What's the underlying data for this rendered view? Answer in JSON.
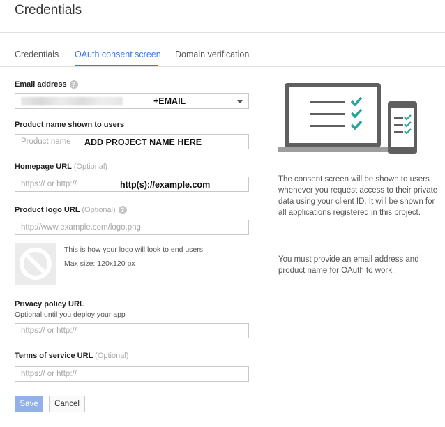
{
  "page": {
    "title": "Credentials"
  },
  "tabs": [
    {
      "label": "Credentials",
      "active": false
    },
    {
      "label": "OAuth consent screen",
      "active": true
    },
    {
      "label": "Domain verification",
      "active": false
    }
  ],
  "form": {
    "email": {
      "label": "Email address",
      "value": "+EMAIL",
      "help_icon": "help-icon"
    },
    "product_name": {
      "label": "Product name shown to users",
      "placeholder": "Product name",
      "value": "ADD PROJECT NAME HERE"
    },
    "homepage": {
      "label": "Homepage URL",
      "optional": "(Optional)",
      "placeholder": "https:// or http://",
      "value": "http(s)://example.com"
    },
    "logo_url": {
      "label": "Product logo URL",
      "optional": "(Optional)",
      "placeholder": "http://www.example.com/logo.png",
      "help_icon": "help-icon"
    },
    "logo_preview": {
      "text": "This is how your logo will look to end users",
      "size": "Max size: 120x120 px"
    },
    "privacy": {
      "label": "Privacy policy URL",
      "sublabel": "Optional until you deploy your app",
      "placeholder": "https:// or http://"
    },
    "terms": {
      "label": "Terms of service URL",
      "optional": "(Optional)",
      "placeholder": "https:// or http://"
    }
  },
  "buttons": {
    "save": "Save",
    "cancel": "Cancel"
  },
  "side": {
    "paragraph1": "The consent screen will be shown to users whenever you request access to their private data using your client ID. It will be shown for all applications registered in this project.",
    "paragraph2": "You must provide an email address and product name for OAuth to work."
  },
  "colors": {
    "accent": "#3b78e7",
    "check": "#26a69a",
    "save_button": "#92b1e8"
  }
}
